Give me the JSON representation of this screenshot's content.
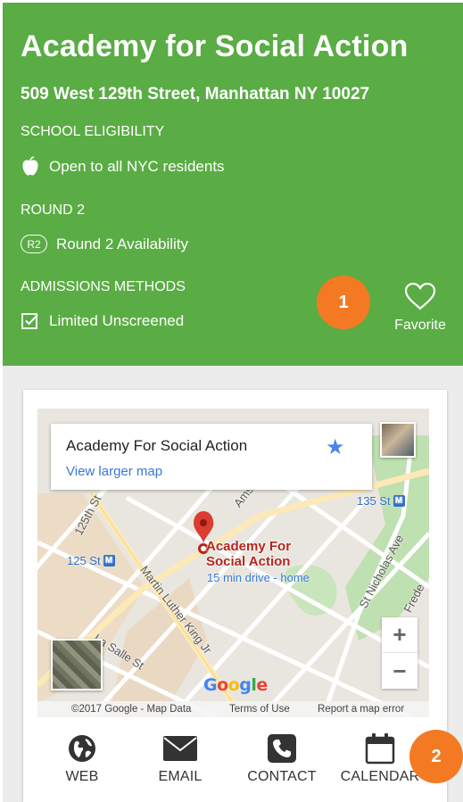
{
  "school": {
    "name": "Academy for Social Action",
    "address": "509 West 129th Street, Manhattan NY 10027"
  },
  "eligibility": {
    "label": "SCHOOL ELIGIBILITY",
    "value": "Open to all NYC residents",
    "icon": "apple-icon"
  },
  "round": {
    "label": "ROUND 2",
    "badge": "R2",
    "value": "Round 2 Availability"
  },
  "admissions": {
    "label": "ADMISSIONS METHODS",
    "value": "Limited Unscreened",
    "icon": "checkbox-icon"
  },
  "favorite": {
    "label": "Favorite",
    "icon": "heart-icon"
  },
  "callouts": [
    "1",
    "2"
  ],
  "map": {
    "info_title": "Academy For Social Action",
    "info_link": "View larger map",
    "pin_label_line1": "Academy For",
    "pin_label_line2": "Social Action",
    "pin_sub": "15 min drive - home",
    "streets": [
      "125th St",
      "Amster",
      "Martin Luther King Jr",
      "La Salle St",
      "St Nicholas Ave",
      "Frede"
    ],
    "stations": [
      {
        "name": "135 St",
        "badge": "M"
      },
      {
        "name": "125 St",
        "badge": "M"
      }
    ],
    "zoom_in": "+",
    "zoom_out": "−",
    "logo": [
      "G",
      "o",
      "o",
      "g",
      "l",
      "e"
    ],
    "footer": {
      "copyright": "©2017 Google - Map Data",
      "terms": "Terms of Use",
      "report": "Report a map error"
    }
  },
  "actions": [
    {
      "label": "WEB",
      "icon": "globe-icon"
    },
    {
      "label": "EMAIL",
      "icon": "envelope-icon"
    },
    {
      "label": "CONTACT",
      "icon": "phone-icon"
    },
    {
      "label": "CALENDAR",
      "icon": "calendar-icon"
    }
  ],
  "colors": {
    "header_green": "#5aac44",
    "callout_orange": "#f37a23",
    "link_blue": "#3a78d6",
    "pin_red": "#b3261e"
  }
}
